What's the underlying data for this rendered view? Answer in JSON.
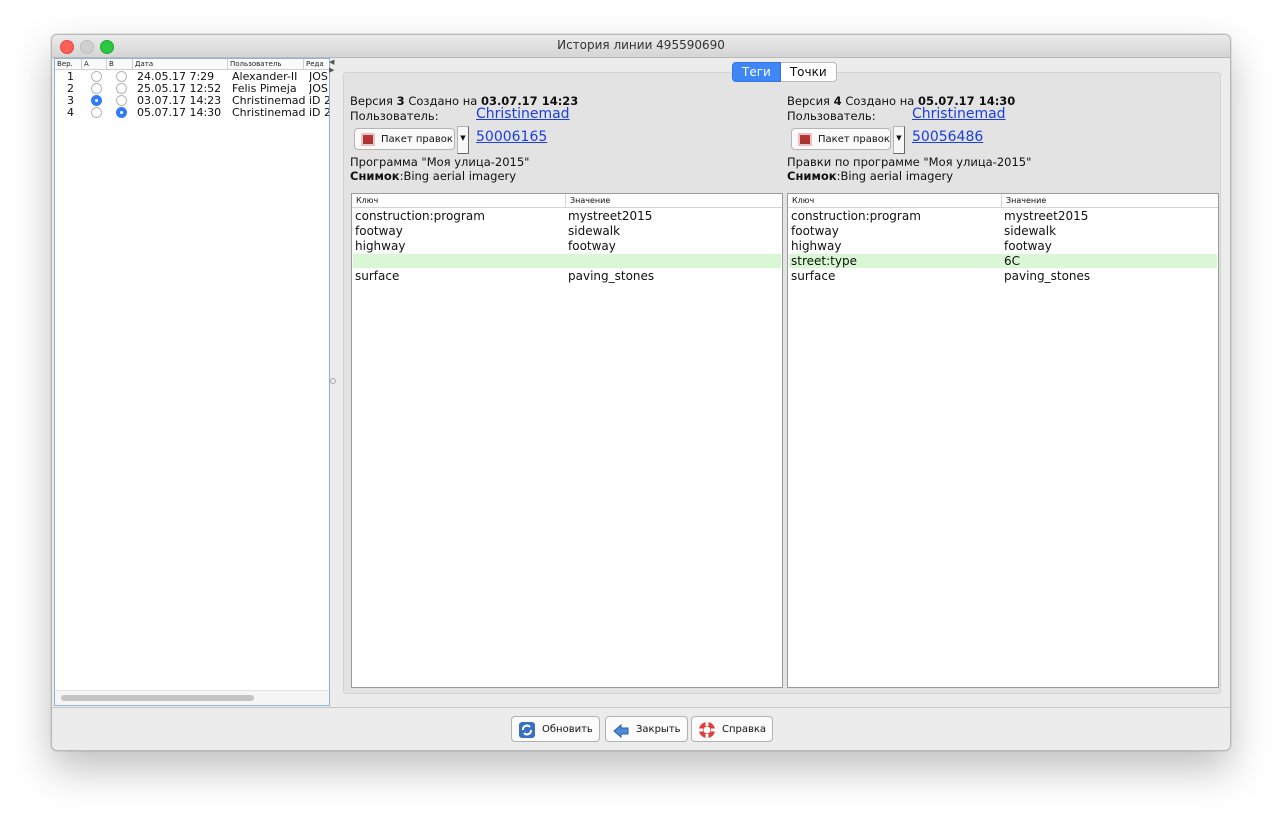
{
  "window": {
    "title": "История линии 495590690"
  },
  "history": {
    "columns": [
      "Вер.",
      "A",
      "B",
      "Дата",
      "Пользователь",
      "Реда"
    ],
    "rows": [
      {
        "ver": "1",
        "a": false,
        "b": false,
        "date": "24.05.17 7:29",
        "user": "Alexander-II",
        "editor": "JOS"
      },
      {
        "ver": "2",
        "a": false,
        "b": false,
        "date": "25.05.17 12:52",
        "user": "Felis Pimeja",
        "editor": "JOS"
      },
      {
        "ver": "3",
        "a": true,
        "b": false,
        "date": "03.07.17 14:23",
        "user": "Christinemad",
        "editor": "iD 2"
      },
      {
        "ver": "4",
        "a": false,
        "b": true,
        "date": "05.07.17 14:30",
        "user": "Christinemad",
        "editor": "iD 2"
      }
    ]
  },
  "tabs": {
    "tags": "Теги",
    "points": "Точки"
  },
  "left_version": {
    "version_prefix": "Версия",
    "version": "3",
    "created_label": "Создано на",
    "created": "03.07.17 14:23",
    "user_label": "Пользователь:",
    "user": "Christinemad",
    "changeset_button": "Пакет правок",
    "changeset": "50006165",
    "comment": "Программа \"Моя улица-2015\"",
    "imagery_label": "Снимок",
    "imagery": "Bing aerial imagery"
  },
  "right_version": {
    "version_prefix": "Версия",
    "version": "4",
    "created_label": "Создано на",
    "created": "05.07.17 14:30",
    "user_label": "Пользователь:",
    "user": "Christinemad",
    "changeset_button": "Пакет правок",
    "changeset": "50056486",
    "comment": "Правки по программе \"Моя улица-2015\"",
    "imagery_label": "Снимок",
    "imagery": "Bing aerial imagery"
  },
  "tag_headers": {
    "key": "Ключ",
    "value": "Значение"
  },
  "left_tags": [
    {
      "k": "construction:program",
      "v": "mystreet2015"
    },
    {
      "k": "footway",
      "v": "sidewalk"
    },
    {
      "k": "highway",
      "v": "footway"
    },
    {
      "k": "",
      "v": "",
      "added": true
    },
    {
      "k": "surface",
      "v": "paving_stones"
    }
  ],
  "right_tags": [
    {
      "k": "construction:program",
      "v": "mystreet2015"
    },
    {
      "k": "footway",
      "v": "sidewalk"
    },
    {
      "k": "highway",
      "v": "footway"
    },
    {
      "k": "street:type",
      "v": "6C",
      "added": true
    },
    {
      "k": "surface",
      "v": "paving_stones"
    }
  ],
  "buttons": {
    "refresh": "Обновить",
    "close": "Закрыть",
    "help": "Справка"
  },
  "colors": {
    "accent": "#3f86f6",
    "added_row": "#d9f7d4",
    "link": "#1a3ee0"
  },
  "icons": {
    "refresh": "refresh-icon",
    "close": "close-arrow-icon",
    "help": "lifebuoy-icon",
    "changeset": "package-icon"
  }
}
